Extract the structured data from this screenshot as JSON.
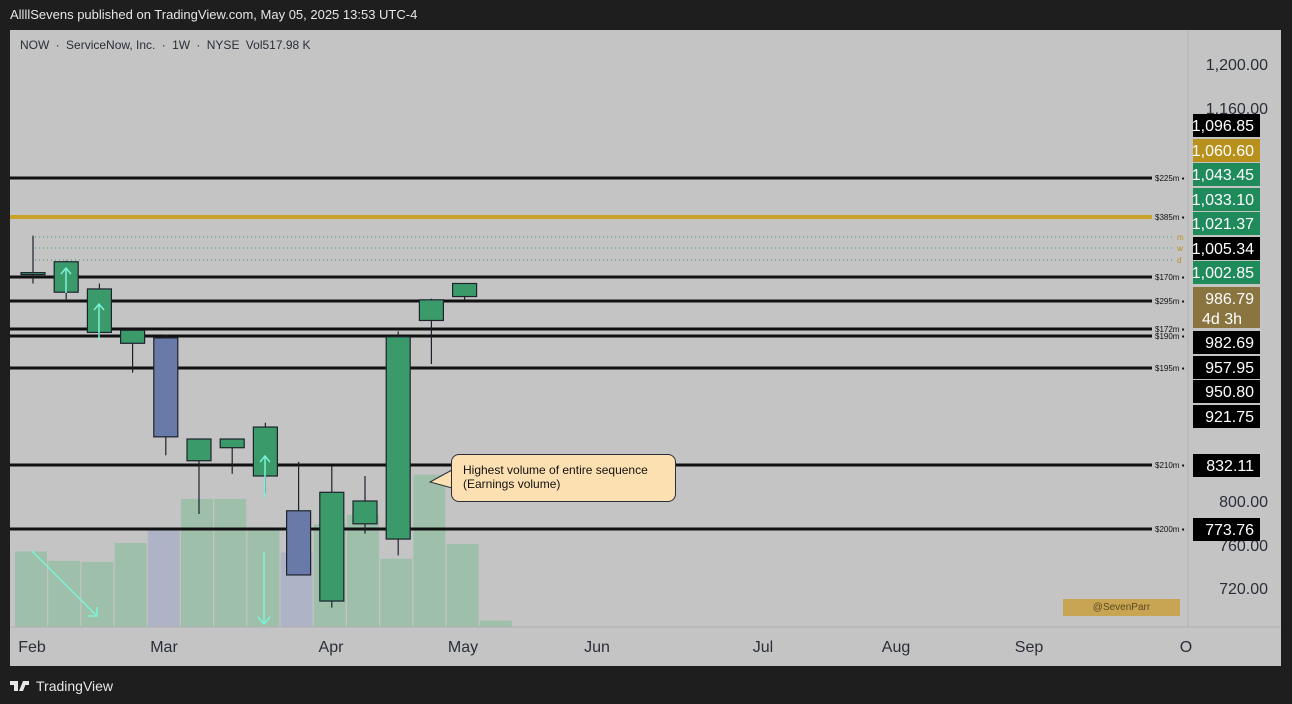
{
  "header": {
    "published": "AllllSevens published on TradingView.com, May 05, 2025 13:53 UTC-4"
  },
  "symbol": {
    "ticker": "NOW",
    "sep1": "·",
    "name": "ServiceNow, Inc.",
    "sep2": "·",
    "interval": "1W",
    "sep3": "·",
    "exchange": "NYSE",
    "volume": "Vol517.98 K"
  },
  "footer": {
    "brand": "TradingView"
  },
  "annotation": {
    "line1": "Highest volume of entire sequence",
    "line2": "(Earnings volume)"
  },
  "watermark": "@SevenParr",
  "colors": {
    "up": "#3a9a6a",
    "down": "#6a7aa8",
    "level_line": "#111111",
    "gold_line": "#c9a227",
    "arrow": "#7ef2d8"
  },
  "chart_data": {
    "type": "candlestick",
    "interval": "1W",
    "y_axis_ticks": [
      "1,200.00",
      "1,160.00",
      "800.00",
      "760.00",
      "720.00"
    ],
    "y_axis_tick_values": [
      1200,
      1160,
      800,
      760,
      720
    ],
    "x_axis_ticks": [
      "Feb",
      "Mar",
      "Apr",
      "May",
      "Jun",
      "Jul",
      "Aug",
      "Sep",
      "O"
    ],
    "candles": [
      {
        "o": 1009,
        "h": 1044,
        "l": 1000,
        "c": 1010
      },
      {
        "o": 992,
        "h": 1021,
        "l": 984,
        "c": 1020
      },
      {
        "o": 955,
        "h": 1000,
        "l": 951,
        "c": 995
      },
      {
        "o": 945,
        "h": 958,
        "l": 918,
        "c": 957
      },
      {
        "o": 950,
        "h": 953,
        "l": 842,
        "c": 859
      },
      {
        "o": 837,
        "h": 848,
        "l": 788,
        "c": 857
      },
      {
        "o": 849,
        "h": 853,
        "l": 825,
        "c": 857
      },
      {
        "o": 823,
        "h": 872,
        "l": 807,
        "c": 868
      },
      {
        "o": 791,
        "h": 836,
        "l": 762,
        "c": 732
      },
      {
        "o": 708,
        "h": 832,
        "l": 702,
        "c": 808
      },
      {
        "o": 779,
        "h": 823,
        "l": 770,
        "c": 800
      },
      {
        "o": 765,
        "h": 956,
        "l": 750,
        "c": 951
      },
      {
        "o": 966,
        "h": 986,
        "l": 926,
        "c": 985
      },
      {
        "o": 988,
        "h": 996,
        "l": 985,
        "c": 1000
      }
    ],
    "volume_relative": [
      0.72,
      0.63,
      0.62,
      0.8,
      0.94,
      1.22,
      1.22,
      0.95,
      0.71,
      0.98,
      1.07,
      0.65,
      1.45,
      0.79,
      0.06
    ],
    "levels": [
      {
        "price": 1096.85,
        "label": "1,096.85",
        "vol": "$225m",
        "bg": "#000000"
      },
      {
        "price": 1060.6,
        "label": "1,060.60",
        "vol": "$385m",
        "bg": "#b8901c"
      },
      {
        "price": 1043.45,
        "label": "1,043.45",
        "vol": "m",
        "bg": "#1f8a5a"
      },
      {
        "price": 1033.1,
        "label": "1,033.10",
        "vol": "w",
        "bg": "#1f8a5a"
      },
      {
        "price": 1021.37,
        "label": "1,021.37",
        "vol": "d",
        "bg": "#1f8a5a"
      },
      {
        "price": 1005.34,
        "label": "1,005.34",
        "vol": "$170m",
        "bg": "#000000"
      },
      {
        "price": 1002.85,
        "label": "1,002.85",
        "vol": "",
        "bg": "#1f8a5a"
      },
      {
        "price": 986.79,
        "label": "986.79",
        "vol": "$295m",
        "bg": "#8a7440"
      },
      {
        "price": 982.69,
        "label": "982.69",
        "vol": "$172m",
        "bg": "#000000"
      },
      {
        "price": 957.95,
        "label": "957.95",
        "vol": "$190m",
        "bg": "#000000"
      },
      {
        "price": 950.8,
        "label": "950.80",
        "vol": "$195m",
        "bg": "#000000"
      },
      {
        "price": 921.75,
        "label": "921.75",
        "vol": "",
        "bg": "#000000"
      },
      {
        "price": 832.11,
        "label": "832.11",
        "vol": "$210m",
        "bg": "#000000"
      },
      {
        "price": 773.76,
        "label": "773.76",
        "vol": "$200m",
        "bg": "#000000"
      }
    ],
    "countdown": "4d 3h"
  }
}
